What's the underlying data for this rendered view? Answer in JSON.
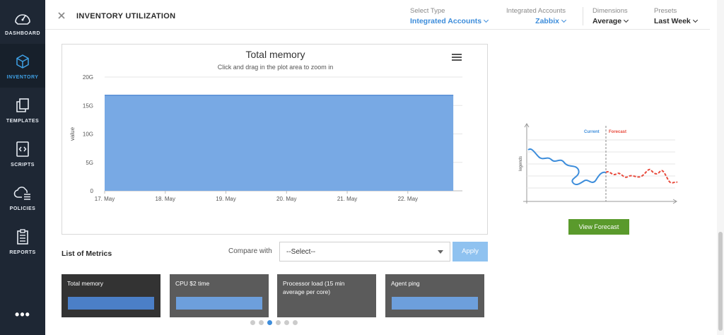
{
  "sidebar": {
    "items": [
      {
        "label": "DASHBOARD",
        "icon": "speedometer-icon",
        "active": false
      },
      {
        "label": "INVENTORY",
        "icon": "cube-icon",
        "active": true
      },
      {
        "label": "TEMPLATES",
        "icon": "copy-icon",
        "active": false
      },
      {
        "label": "SCRIPTS",
        "icon": "code-file-icon",
        "active": false
      },
      {
        "label": "POLICIES",
        "icon": "cloud-settings-icon",
        "active": false
      },
      {
        "label": "REPORTS",
        "icon": "clipboard-icon",
        "active": false
      }
    ],
    "more_label": "•••"
  },
  "header": {
    "title": "INVENTORY UTILIZATION",
    "filters": [
      {
        "label": "Select Type",
        "value": "Integrated Accounts"
      },
      {
        "label": "Integrated Accounts",
        "value": "Zabbix"
      },
      {
        "label": "Dimensions",
        "value": "Average"
      },
      {
        "label": "Presets",
        "value": "Last Week"
      }
    ]
  },
  "chart_data": {
    "type": "area",
    "title": "Total memory",
    "subtitle": "Click and drag in the plot area to zoom in",
    "ylabel": "value",
    "xlabel": "",
    "y_ticks": [
      "0",
      "5G",
      "10G",
      "15G",
      "20G"
    ],
    "ylim": [
      0,
      20
    ],
    "x_ticks": [
      "17. May",
      "18. May",
      "19. May",
      "20. May",
      "21. May",
      "22. May"
    ],
    "series": [
      {
        "values": [
          {
            "x": "17. May",
            "y": 16.8
          },
          {
            "x": "22. May",
            "y": 16.8
          }
        ],
        "x_start_day": 17.0,
        "x_end_day": 22.75
      }
    ],
    "grid": true,
    "fill_color": "#78a9e4"
  },
  "forecast": {
    "current_label": "Current",
    "forecast_label": "Forecast",
    "y_label": "legends",
    "button_label": "View Forecast",
    "current_color": "#3d8ddb",
    "forecast_color": "#e84a3c"
  },
  "metrics": {
    "title": "List of Metrics",
    "compare_label": "Compare with",
    "select_value": "--Select--",
    "apply_label": "Apply",
    "cards": [
      {
        "label": "Total memory",
        "selected": true
      },
      {
        "label": "CPU $2 time",
        "selected": false
      },
      {
        "label": "Processor load (15 min average per core)",
        "selected": false
      },
      {
        "label": "Agent ping",
        "selected": false
      }
    ],
    "carousel_pages": 6,
    "carousel_active": 2
  },
  "colors": {
    "sidebar_bg": "#1e2734",
    "accent": "#3d8ddb",
    "apply_bg": "#8fc2f0",
    "forecast_button_bg": "#5a9a2c"
  }
}
